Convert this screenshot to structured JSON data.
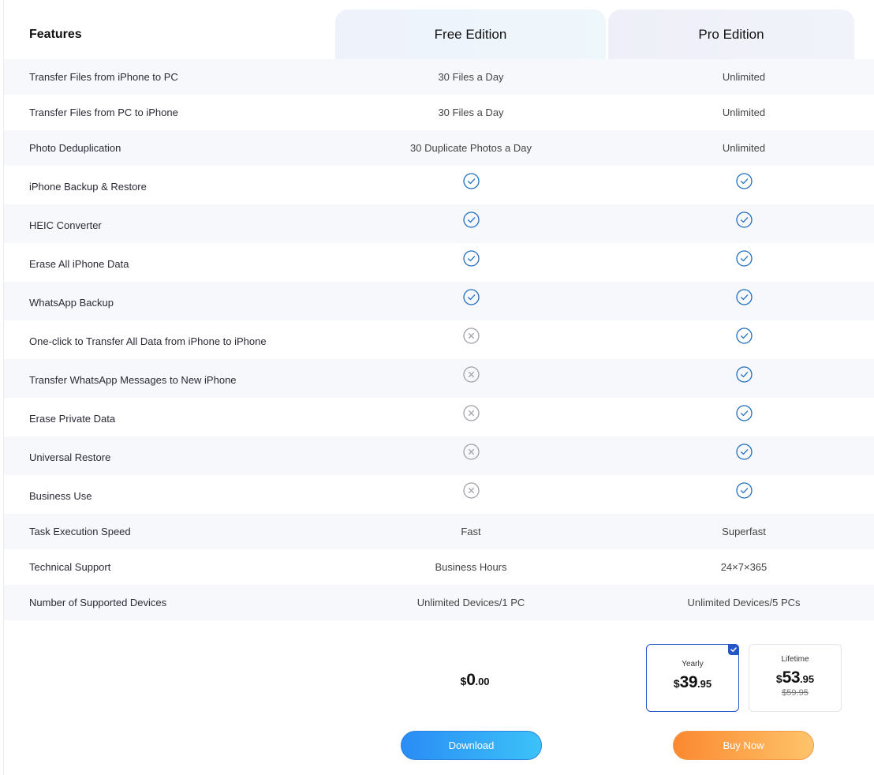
{
  "header": {
    "features_label": "Features",
    "free_label": "Free Edition",
    "pro_label": "Pro Edition"
  },
  "rows": [
    {
      "feature": "Transfer Files from iPhone to PC",
      "free": "30 Files a Day",
      "pro": "Unlimited"
    },
    {
      "feature": "Transfer Files from PC to iPhone",
      "free": "30 Files a Day",
      "pro": "Unlimited"
    },
    {
      "feature": "Photo Deduplication",
      "free": "30 Duplicate Photos a Day",
      "pro": "Unlimited"
    },
    {
      "feature": "iPhone Backup & Restore",
      "free": "check-icon",
      "pro": "check-icon"
    },
    {
      "feature": "HEIC Converter",
      "free": "check-icon",
      "pro": "check-icon"
    },
    {
      "feature": "Erase All iPhone Data",
      "free": "check-icon",
      "pro": "check-icon"
    },
    {
      "feature": "WhatsApp Backup",
      "free": "check-icon",
      "pro": "check-icon"
    },
    {
      "feature": "One-click to Transfer All Data from iPhone to iPhone",
      "free": "cross-icon",
      "pro": "check-icon"
    },
    {
      "feature": "Transfer WhatsApp Messages to New iPhone",
      "free": "cross-icon",
      "pro": "check-icon"
    },
    {
      "feature": "Erase Private Data",
      "free": "cross-icon",
      "pro": "check-icon"
    },
    {
      "feature": "Universal Restore",
      "free": "cross-icon",
      "pro": "check-icon"
    },
    {
      "feature": "Business Use",
      "free": "cross-icon",
      "pro": "check-icon"
    },
    {
      "feature": "Task Execution Speed",
      "free": "Fast",
      "pro": "Superfast"
    },
    {
      "feature": "Technical Support",
      "free": "Business Hours",
      "pro": "24×7×365"
    },
    {
      "feature": "Number of Supported Devices",
      "free": "Unlimited Devices/1 PC",
      "pro": "Unlimited Devices/5 PCs"
    }
  ],
  "pricing": {
    "free": {
      "currency": "$",
      "whole": "0",
      "cents": ".00"
    },
    "yearly": {
      "name": "Yearly",
      "currency": "$",
      "whole": "39",
      "cents": ".95",
      "selected": true
    },
    "lifetime": {
      "name": "Lifetime",
      "currency": "$",
      "whole": "53",
      "cents": ".95",
      "original": "$59.95"
    }
  },
  "buttons": {
    "download": "Download",
    "buy": "Buy Now"
  },
  "colors": {
    "check": "#1f6fbe",
    "cross": "#a0a0a8",
    "accent_blue": "#2356c6",
    "download_gradient": [
      "#2a8cf5",
      "#3cc2f8"
    ],
    "buy_gradient": [
      "#fb8830",
      "#fec46a"
    ]
  }
}
